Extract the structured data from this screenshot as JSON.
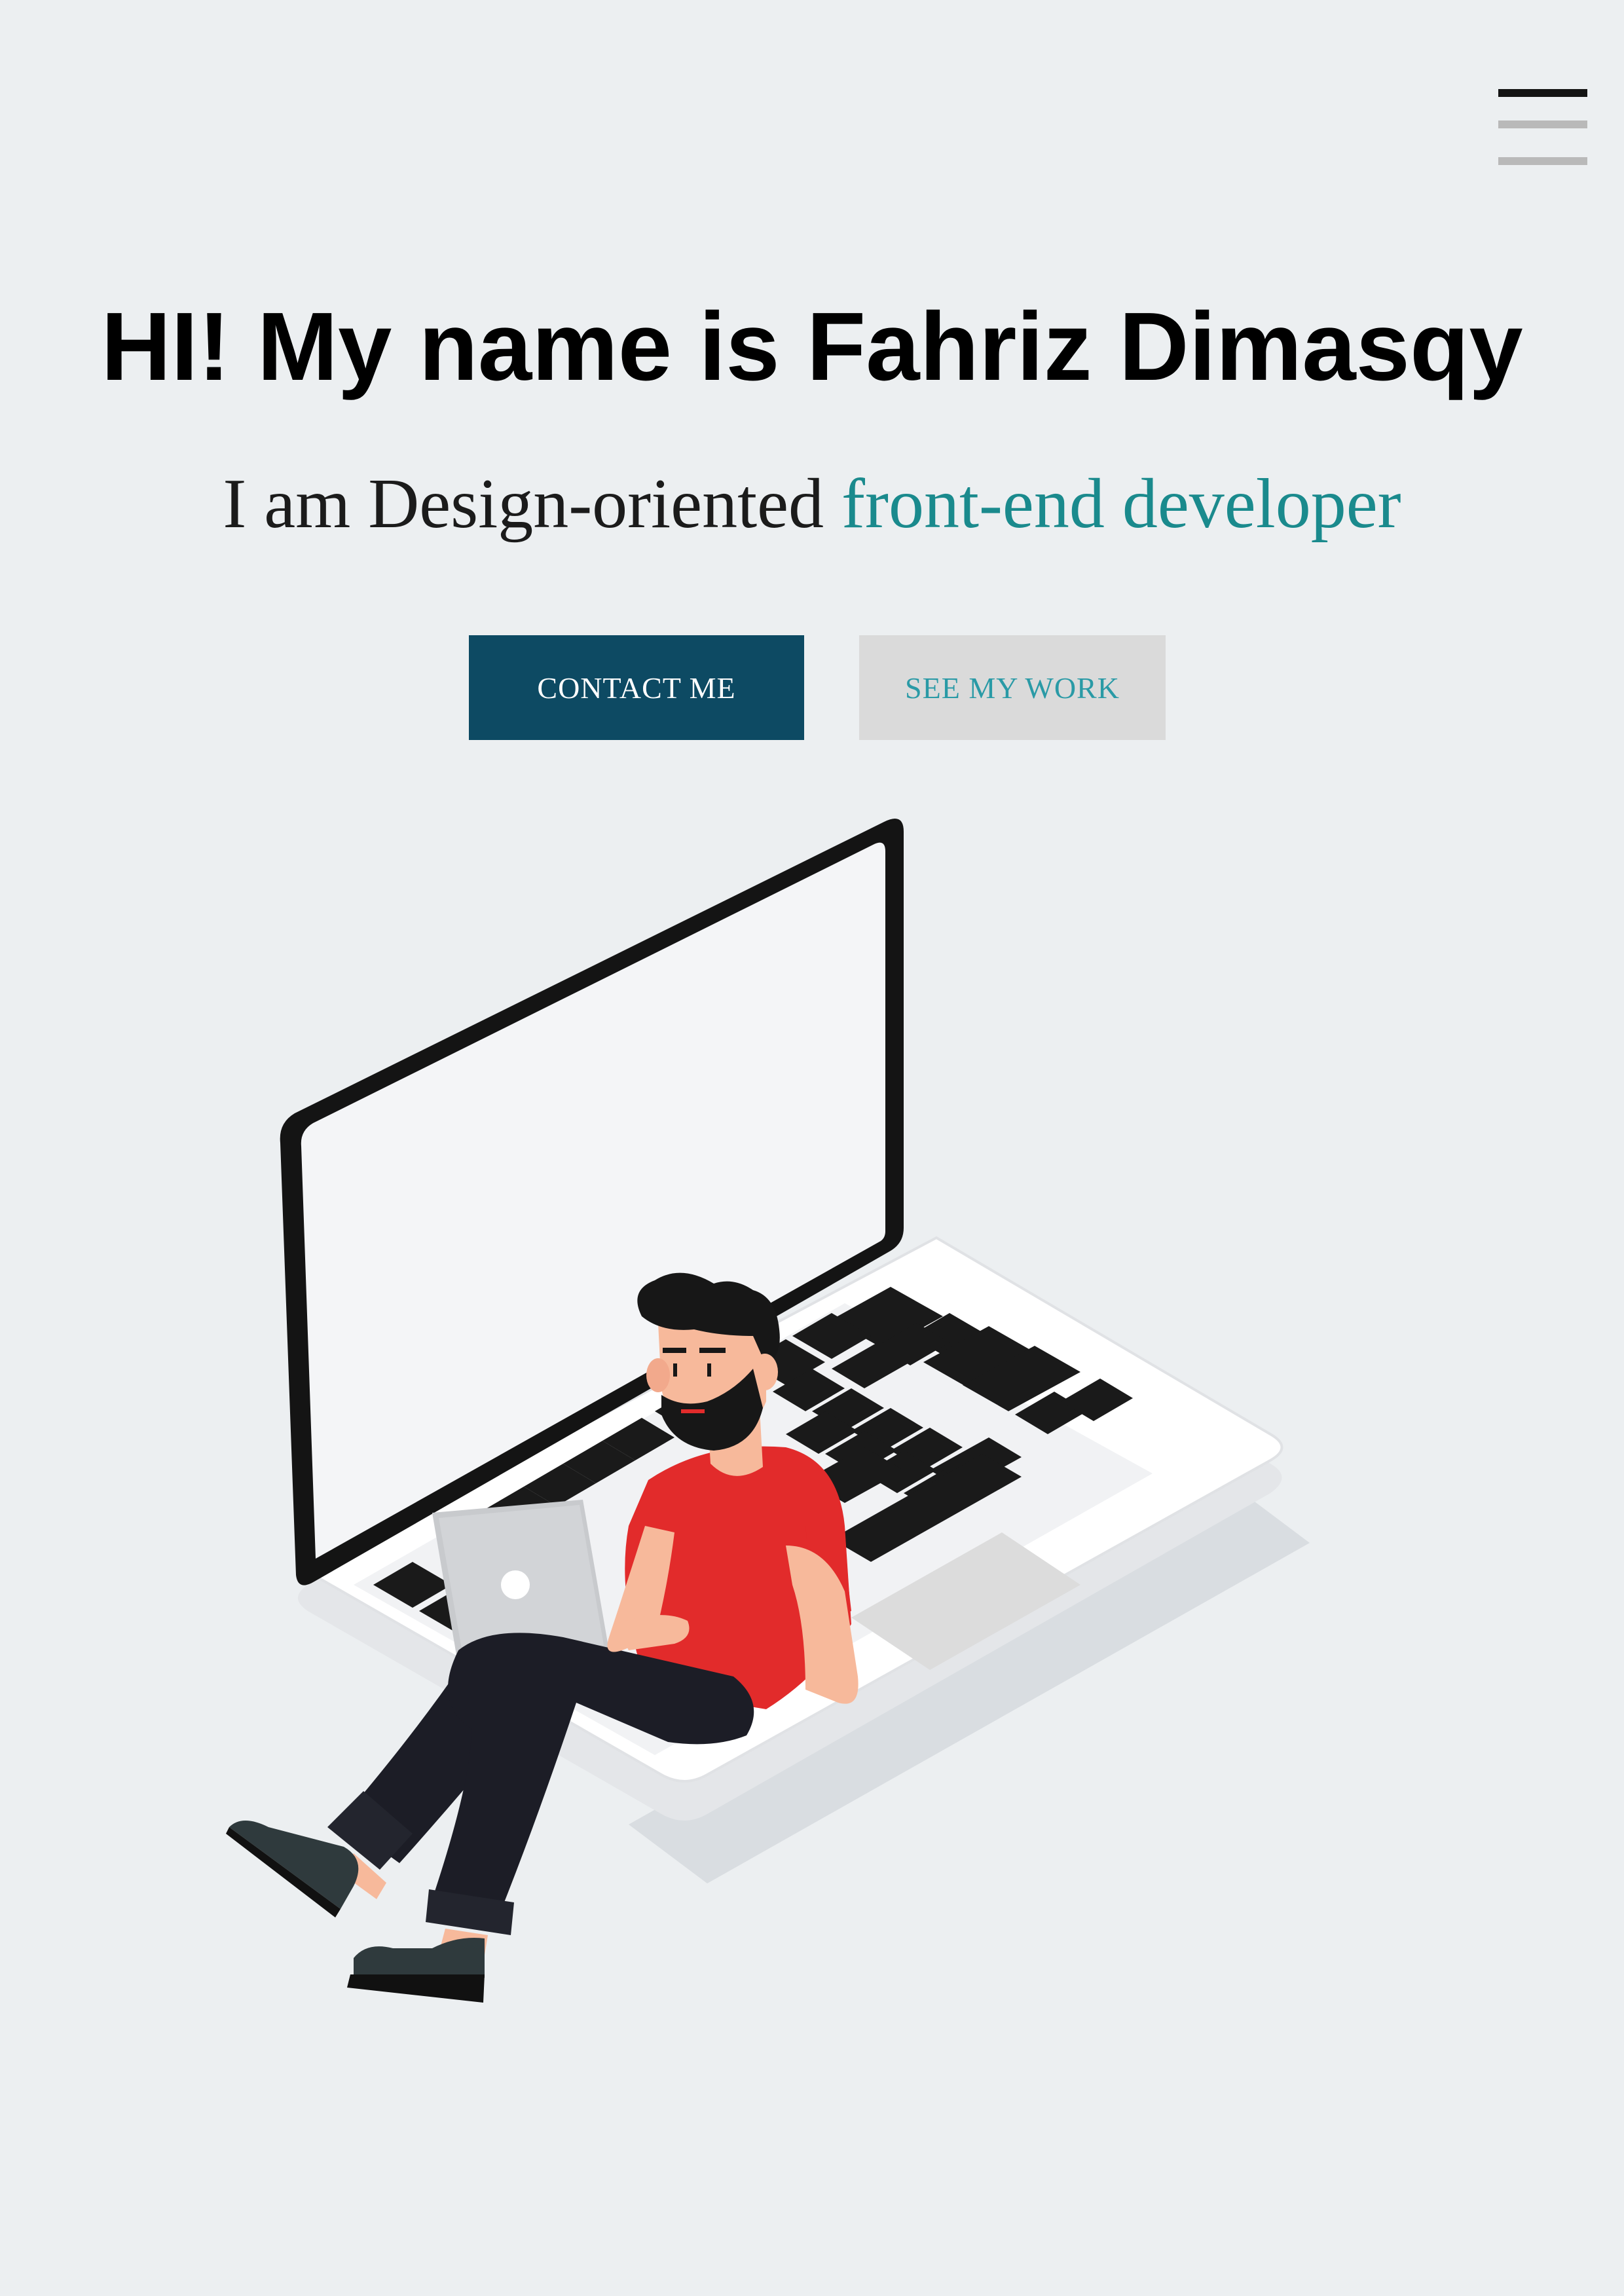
{
  "header": {
    "menu_icon": "hamburger-menu-icon"
  },
  "hero": {
    "title": "HI! My name is Fahriz Dimasqy",
    "subtitle_prefix": "I am Design-oriented ",
    "subtitle_accent": "front-end developer",
    "accent_color": "#1a8a8d"
  },
  "actions": {
    "contact_label": "CONTACT ME",
    "contact_color": "#0d4a63",
    "work_label": "SEE MY WORK",
    "work_color": "#2a9aa6"
  },
  "illustration": {
    "name": "developer-sitting-on-laptop-illustration"
  },
  "colors": {
    "background": "#eceff1",
    "shirt": "#e22b2b",
    "pants": "#1c1d26",
    "skin": "#f7b99b"
  }
}
